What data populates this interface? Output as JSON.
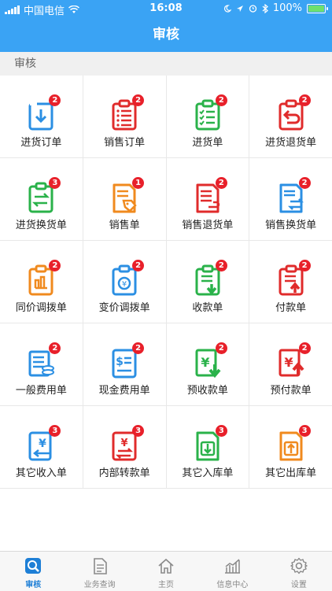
{
  "status": {
    "carrier": "中国电信",
    "time": "16:08",
    "battery": "100%"
  },
  "nav": {
    "title": "审核"
  },
  "section": {
    "title": "审核"
  },
  "items": [
    {
      "label": "进货订单",
      "badge": "2",
      "color": "#2b8fe3",
      "icon": "download-box-icon"
    },
    {
      "label": "销售订单",
      "badge": "2",
      "color": "#e02b2b",
      "icon": "list-clipboard-icon"
    },
    {
      "label": "进货单",
      "badge": "2",
      "color": "#2ab24a",
      "icon": "checklist-clipboard-icon"
    },
    {
      "label": "进货退货单",
      "badge": "2",
      "color": "#e02b2b",
      "icon": "return-clipboard-icon"
    },
    {
      "label": "进货换货单",
      "badge": "3",
      "color": "#2ab24a",
      "icon": "exchange-clipboard-icon"
    },
    {
      "label": "销售单",
      "badge": "1",
      "color": "#f08a1e",
      "icon": "tag-document-icon"
    },
    {
      "label": "销售退货单",
      "badge": "2",
      "color": "#e02b2b",
      "icon": "return-document-icon"
    },
    {
      "label": "销售换货单",
      "badge": "2",
      "color": "#2b8fe3",
      "icon": "exchange-document-icon"
    },
    {
      "label": "同价调拨单",
      "badge": "2",
      "color": "#f08a1e",
      "icon": "transfer-clipboard-icon"
    },
    {
      "label": "变价调拨单",
      "badge": "2",
      "color": "#2b8fe3",
      "icon": "price-transfer-clipboard-icon"
    },
    {
      "label": "收款单",
      "badge": "2",
      "color": "#2ab24a",
      "icon": "receive-clipboard-icon"
    },
    {
      "label": "付款单",
      "badge": "2",
      "color": "#e02b2b",
      "icon": "pay-clipboard-icon"
    },
    {
      "label": "一般费用单",
      "badge": "2",
      "color": "#2b8fe3",
      "icon": "expense-coins-icon"
    },
    {
      "label": "现金费用单",
      "badge": "2",
      "color": "#2b8fe3",
      "icon": "cash-document-icon"
    },
    {
      "label": "预收款单",
      "badge": "2",
      "color": "#2ab24a",
      "icon": "yuan-down-icon"
    },
    {
      "label": "预付款单",
      "badge": "2",
      "color": "#e02b2b",
      "icon": "yuan-up-icon"
    },
    {
      "label": "其它收入单",
      "badge": "3",
      "color": "#2b8fe3",
      "icon": "yuan-in-icon"
    },
    {
      "label": "内部转款单",
      "badge": "3",
      "color": "#e02b2b",
      "icon": "yuan-transfer-icon"
    },
    {
      "label": "其它入库单",
      "badge": "3",
      "color": "#2ab24a",
      "icon": "stock-in-icon"
    },
    {
      "label": "其它出库单",
      "badge": "3",
      "color": "#f08a1e",
      "icon": "stock-out-icon"
    }
  ],
  "tabs": [
    {
      "label": "审核",
      "icon": "audit-icon",
      "active": true
    },
    {
      "label": "业务查询",
      "icon": "document-icon",
      "active": false
    },
    {
      "label": "主页",
      "icon": "home-icon",
      "active": false
    },
    {
      "label": "信息中心",
      "icon": "chart-icon",
      "active": false
    },
    {
      "label": "设置",
      "icon": "gear-icon",
      "active": false
    }
  ]
}
